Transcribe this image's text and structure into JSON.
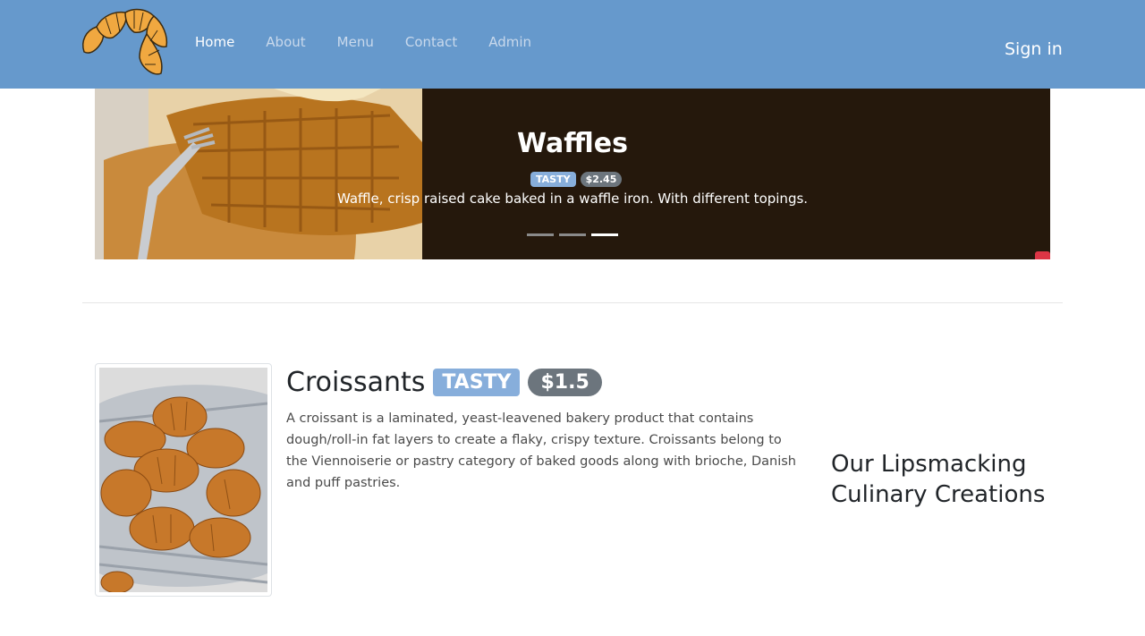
{
  "nav": {
    "links": [
      {
        "label": "Home",
        "active": true
      },
      {
        "label": "About",
        "active": false
      },
      {
        "label": "Menu",
        "active": false
      },
      {
        "label": "Contact",
        "active": false
      },
      {
        "label": "Admin",
        "active": false
      }
    ],
    "signin": "Sign in"
  },
  "carousel": {
    "title": "Waffles",
    "badge": "TASTY",
    "price": "$2.45",
    "description": "Waffle, crisp raised cake baked in a waffle iron. With different topings.",
    "active_slide": 3,
    "slide_count": 3
  },
  "product": {
    "title": "Croissants",
    "badge": "TASTY",
    "price": "$1.5",
    "description": "A croissant is a laminated, yeast-leavened bakery product that contains dough/roll-in fat layers to create a flaky, crispy texture. Croissants belong to the Viennoiserie or pastry category of baked goods along with brioche, Danish and puff pastries."
  },
  "side_heading": "Our Lipsmacking Culinary Creations",
  "colors": {
    "navbar": "#6699cc",
    "carousel_bg": "#25180c",
    "badge_tasty": "#87aedb",
    "badge_price": "#6c757d"
  }
}
